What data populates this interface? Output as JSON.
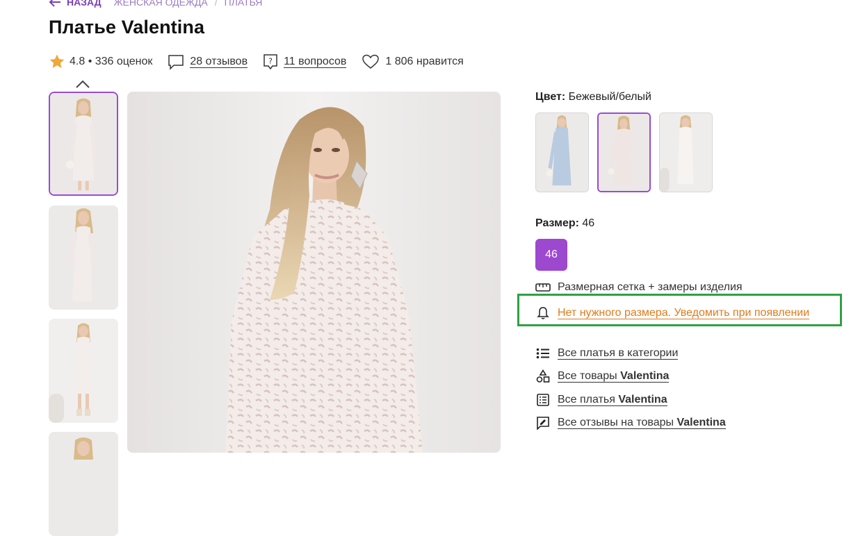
{
  "nav": {
    "back_label": "НАЗАД",
    "breadcrumbs": [
      "ЖЕНСКАЯ ОДЕЖДА",
      "ПЛАТЬЯ"
    ],
    "separator": "/"
  },
  "product": {
    "title": "Платье Valentina",
    "rating": "4.8",
    "ratings_count": "• 336 оценок",
    "reviews": "28 отзывов",
    "questions": "11 вопросов",
    "likes": "1 806 нравится"
  },
  "color": {
    "label": "Цвет:",
    "value": "Бежевый/белый",
    "options": [
      "light-blue dress",
      "beige/white dress",
      "white dress"
    ],
    "selected_index": 1
  },
  "size": {
    "label": "Размер:",
    "value": "46",
    "options": [
      "46"
    ]
  },
  "links": {
    "size_chart": "Размерная сетка + замеры изделия",
    "notify": "Нет нужного размера. Уведомить при появлении",
    "all_category": "Все платья в категории",
    "all_goods_prefix": "Все товары",
    "all_dresses_prefix": "Все платья",
    "all_reviews_prefix": "Все отзывы на товары",
    "brand": "Valentina"
  },
  "colors": {
    "accent": "#9c48cf",
    "highlight": "#2ea044",
    "notify": "#e07b1b"
  }
}
